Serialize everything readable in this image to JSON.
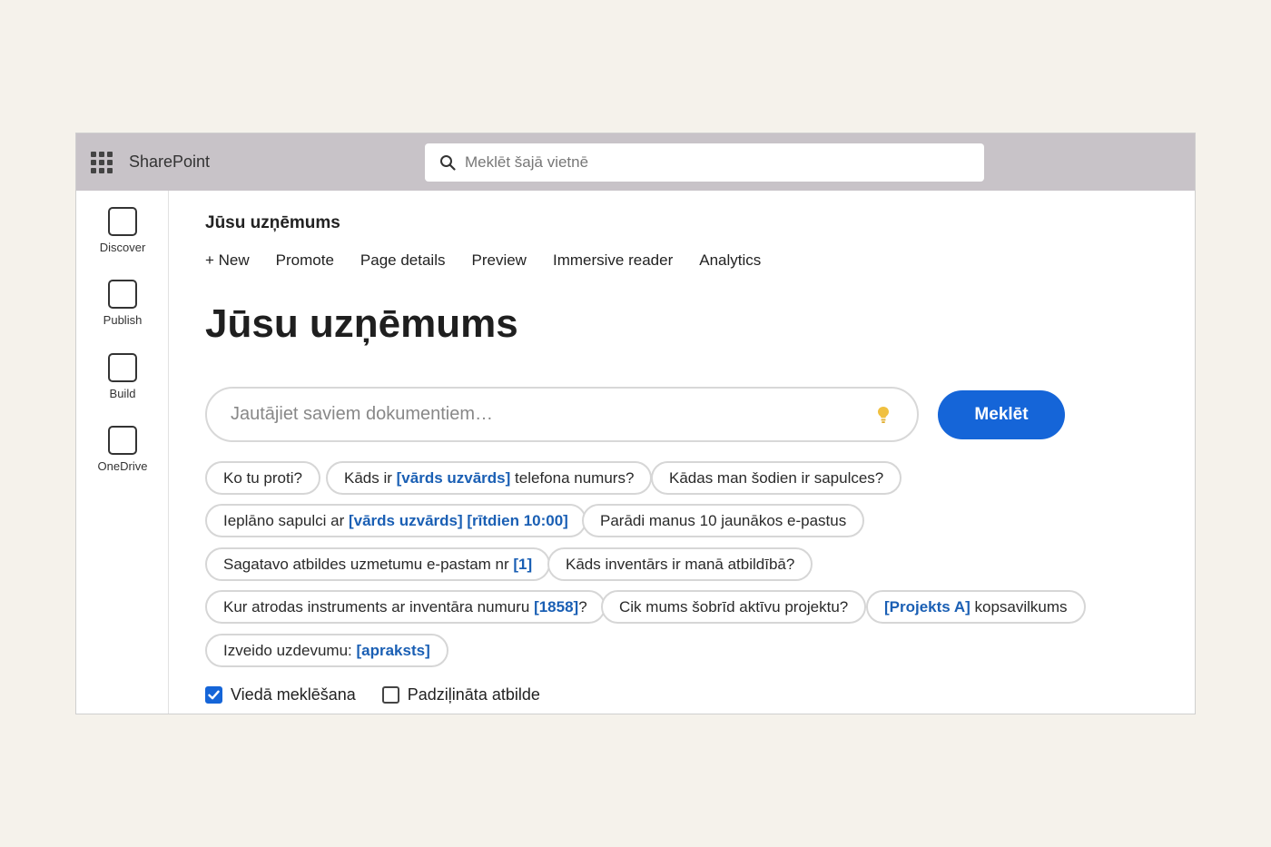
{
  "header": {
    "app_title": "SharePoint",
    "search_placeholder": "Meklēt šajā vietnē"
  },
  "sidebar": {
    "items": [
      {
        "label": "Discover"
      },
      {
        "label": "Publish"
      },
      {
        "label": "Build"
      },
      {
        "label": "OneDrive"
      }
    ]
  },
  "page": {
    "site_name": "Jūsu uzņēmums",
    "commands": [
      "+ New",
      "Promote",
      "Page details",
      "Preview",
      "Immersive reader",
      "Analytics"
    ],
    "title": "Jūsu uzņēmums"
  },
  "ask": {
    "placeholder": "Jautājiet saviem dokumentiem…",
    "icon": "lightbulb-icon",
    "button_label": "Meklēt"
  },
  "suggestions": [
    {
      "parts": [
        {
          "t": "Ko tu proti?"
        }
      ]
    },
    {
      "parts": [
        {
          "t": "Kāds ir "
        },
        {
          "t": "[vārds uzvārds]",
          "ph": true
        },
        {
          "t": " telefona numurs?"
        }
      ]
    },
    {
      "parts": [
        {
          "t": "Kādas man šodien ir sapulces?"
        }
      ]
    },
    {
      "parts": [
        {
          "t": "Ieplāno sapulci ar "
        },
        {
          "t": "[vārds uzvārds] [rītdien 10:00]",
          "ph": true
        }
      ]
    },
    {
      "parts": [
        {
          "t": "Parādi manus 10 jaunākos e-pastus"
        }
      ]
    },
    {
      "parts": [
        {
          "t": "Sagatavo atbildes uzmetumu e-pastam nr "
        },
        {
          "t": "[1]",
          "ph": true
        }
      ]
    },
    {
      "parts": [
        {
          "t": "Kāds inventārs ir manā atbildībā?"
        }
      ]
    },
    {
      "parts": [
        {
          "t": "Kur atrodas instruments ar inventāra numuru "
        },
        {
          "t": "[1858]",
          "ph": true
        },
        {
          "t": "?"
        }
      ]
    },
    {
      "parts": [
        {
          "t": "Cik mums šobrīd aktīvu projektu?"
        }
      ]
    },
    {
      "parts": [
        {
          "t": "[Projekts A]",
          "ph": true
        },
        {
          "t": " kopsavilkums"
        }
      ]
    },
    {
      "parts": [
        {
          "t": "Izveido uzdevumu: "
        },
        {
          "t": "[apraksts]",
          "ph": true
        }
      ]
    }
  ],
  "options": [
    {
      "label": "Viedā meklēšana",
      "checked": true
    },
    {
      "label": "Padziļināta atbilde",
      "checked": false
    }
  ],
  "colors": {
    "accent": "#1565d8",
    "placeholder_text": "#1a5fb4",
    "topbar": "#c8c3c8"
  }
}
